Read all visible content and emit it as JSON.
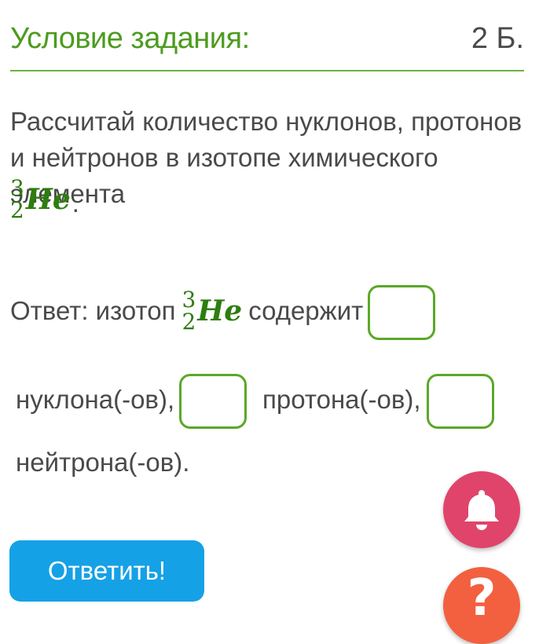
{
  "header": {
    "title": "Условие задания:",
    "points": "2 Б."
  },
  "question": {
    "text": "Рассчитай количество нуклонов, протонов и нейтронов в изотопе химического элемента",
    "isotope": {
      "mass": "3",
      "atomic": "2",
      "symbol": "He"
    },
    "end_punct": "."
  },
  "answer": {
    "prefix": "Ответ: изотоп",
    "isotope": {
      "mass": "3",
      "atomic": "2",
      "symbol": "He"
    },
    "contains": "содержит",
    "label_nucleons": "нуклона(-ов),",
    "label_protons": "протона(-ов),",
    "label_neutrons": "нейтрона(-ов).",
    "inputs": {
      "nucleons": "",
      "protons": "",
      "neutrons": ""
    }
  },
  "submit_label": "Ответить!",
  "icons": {
    "notification": "bell-icon",
    "help": "question-mark-icon"
  },
  "colors": {
    "accent_green": "#4c9c1e",
    "box_border": "#5aa827",
    "button_blue": "#15a1e6",
    "bell_pink": "#e0446b",
    "help_orange": "#f2603f"
  }
}
